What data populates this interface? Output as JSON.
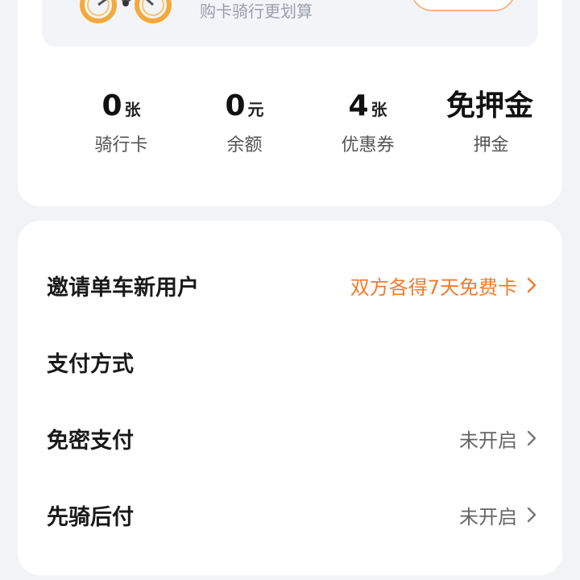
{
  "promo": {
    "subtitle": "购卡骑行更划算",
    "icons": [
      "bicycle-icon"
    ]
  },
  "stats": [
    {
      "value": "0",
      "unit": "张",
      "label": "骑行卡"
    },
    {
      "value": "0",
      "unit": "元",
      "label": "余额"
    },
    {
      "value": "4",
      "unit": "张",
      "label": "优惠券"
    },
    {
      "value": "免押金",
      "unit": "",
      "label": "押金"
    }
  ],
  "menu": {
    "invite": {
      "title": "邀请单车新用户",
      "value": "双方各得7天免费卡"
    },
    "payment_method": {
      "title": "支付方式"
    },
    "password_free": {
      "title": "免密支付",
      "value": "未开启"
    },
    "ride_first_pay_later": {
      "title": "先骑后付",
      "value": "未开启"
    }
  },
  "colors": {
    "accent": "#f07a2e",
    "background": "#f2f3f5",
    "card": "#ffffff"
  }
}
